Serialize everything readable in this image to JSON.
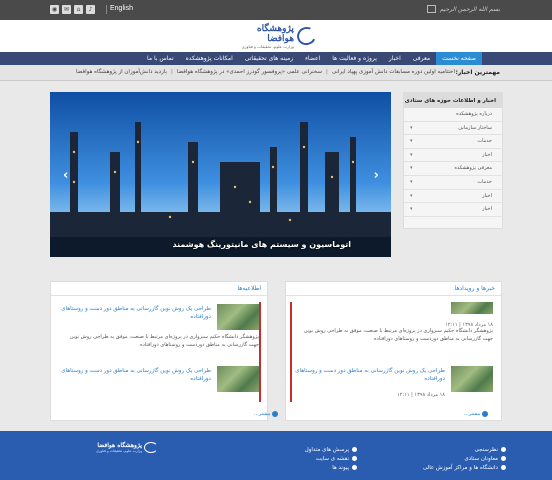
{
  "topbar": {
    "language": "English",
    "icons": [
      "rss-icon",
      "mail-icon",
      "home-icon",
      "sound-icon"
    ],
    "signature": "بسم الله الرحمن الرحيم"
  },
  "header": {
    "logo_title": "پژوهشگاه هوافضا",
    "logo_subtitle": "وزارت علوم، تحقیقات و فناوری"
  },
  "nav": {
    "items": [
      "صفحه نخست",
      "معرفی",
      "اخبار",
      "پروژه و فعالیت ها",
      "اعضاء",
      "زمینه های تحقیقاتی",
      "امکانات پژوهشکده",
      "تماس با ما"
    ]
  },
  "ticker": {
    "label": "مهمترین اخبار:",
    "items": [
      "اختتامیه اولین دوره مسابقات دانش آموزی پهپاد ایرانی",
      "سخنرانی علمی «پروفسور گودرز احمدی» در پژوهشگاه هوافضا",
      "بازدید دانش‌آموزان از پژوهشگاه هوافضا"
    ]
  },
  "slider": {
    "caption": "اتوماسیون و سیستم های مانیتورینگ هوشمند",
    "prev_label": "‹",
    "next_label": "›"
  },
  "side": {
    "title": "اخبار و اطلاعات حوزه های ستادی",
    "items": [
      "درباره پژوهشکده",
      "ساختار سازمانی",
      "خدمات",
      "اخبار",
      "معرفی پژوهشکده",
      "خدمات",
      "اخبار",
      "اخبار"
    ]
  },
  "panels": {
    "left": {
      "title": "اطلاعیه‌ها",
      "more": "بیشتر...",
      "news": [
        {
          "title": "طراحی یک روش نوین گازرسانی به مناطق دور دست و روستاهای دورافتاده",
          "meta": "",
          "summary": "پژوهشگر دانشگاه حکیم سبزواری در پروژه‌ای مرتبط با صنعت، موفق به طراحی روش نوین جهت گازرسانی به مناطق دوردست و روستاهای دورافتاده"
        },
        {
          "title": "طراحی یک روش نوین گازرسانی به مناطق دور دست و روستاهای دورافتاده",
          "meta": "",
          "summary": ""
        }
      ]
    },
    "right": {
      "title": "خبرها و رویدادها",
      "more": "بیشتر...",
      "news": [
        {
          "title": "طراحی یک روش نوین گازرسانی به مناطق دور دست و روستاهای دورافتاده",
          "meta": "۱۸ مرداد ۱۳۹۸ | ۱۲:۱۱",
          "summary": "پژوهشگر دانشگاه حکیم سبزواری در پروژه‌ای مرتبط با صنعت، موفق به طراحی روش نوین جهت گازرسانی به مناطق دوردست و روستاهای دورافتاده"
        },
        {
          "title": "طراحی یک روش نوین گازرسانی به مناطق دور دست و روستاهای دورافتاده",
          "meta": "۱۸ مرداد ۱۳۹۸ | ۱۲:۱۱",
          "summary": ""
        }
      ]
    }
  },
  "footer": {
    "col1": [
      "نظرسنجی",
      "معاونان ستادی",
      "دانشگاه ها و مراکز آموزش عالی"
    ],
    "col2": [
      "پرسش های متداول",
      "نقشه ی سایت",
      "پیوند ها"
    ],
    "logo_title": "پژوهشگاه هوافضا",
    "logo_subtitle": "وزارت علوم، تحقیقات و فناوری"
  },
  "colors": {
    "nav_bg": "#384975",
    "nav_active": "#2b8cd6",
    "footer_bg": "#2a5db0",
    "link": "#2b7fc9",
    "scroll_accent": "#c62d2d"
  }
}
